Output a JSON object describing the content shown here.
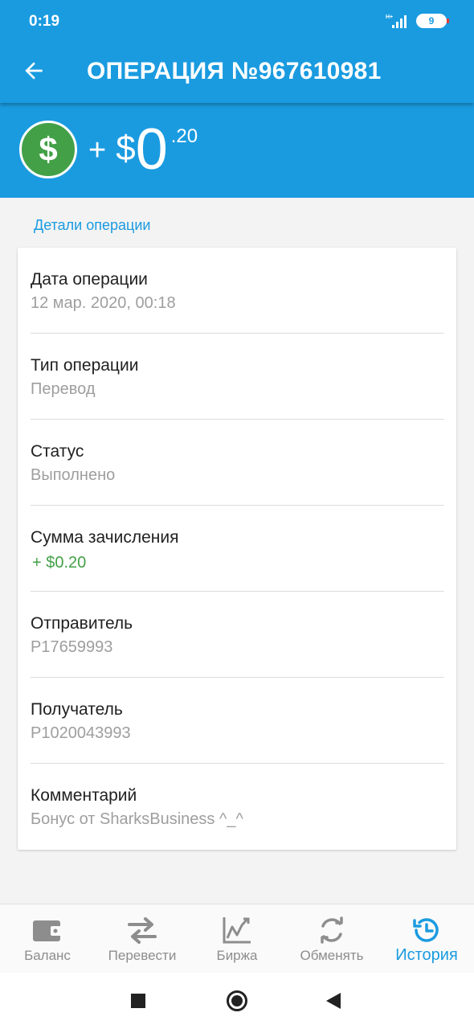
{
  "status_bar": {
    "time": "0:19",
    "network": "H+",
    "battery": "9"
  },
  "header": {
    "title": "ОПЕРАЦИЯ №967610981"
  },
  "hero": {
    "sign": "+",
    "currency": "$",
    "integer": "0",
    "fraction": ".20"
  },
  "section": {
    "label": "Детали операции"
  },
  "details": [
    {
      "label": "Дата операции",
      "value": "12 мар. 2020, 00:18"
    },
    {
      "label": "Тип операции",
      "value": "Перевод"
    },
    {
      "label": "Статус",
      "value": "Выполнено"
    },
    {
      "label": "Сумма зачисления",
      "value": "+ $0.20"
    },
    {
      "label": "Отправитель",
      "value": "P17659993"
    },
    {
      "label": "Получатель",
      "value": "P1020043993"
    },
    {
      "label": "Комментарий",
      "value": "Бонус от SharksBusiness ^_^"
    }
  ],
  "bottom_nav": [
    {
      "label": "Баланс",
      "icon": "wallet-icon"
    },
    {
      "label": "Перевести",
      "icon": "transfer-icon"
    },
    {
      "label": "Биржа",
      "icon": "chart-icon"
    },
    {
      "label": "Обменять",
      "icon": "exchange-icon"
    },
    {
      "label": "История",
      "icon": "history-icon",
      "active": true
    }
  ],
  "colors": {
    "primary": "#1a9be0",
    "success": "#43a047",
    "muted": "#9e9e9e"
  }
}
